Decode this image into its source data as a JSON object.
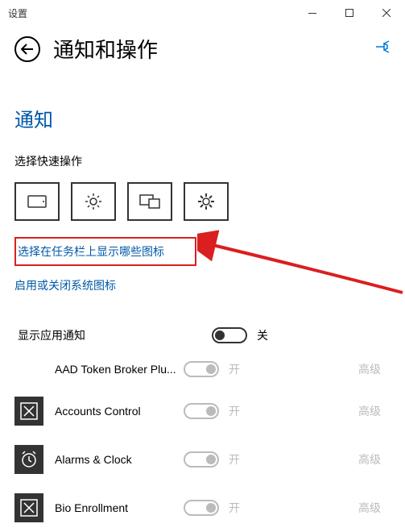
{
  "window": {
    "title": "设置"
  },
  "header": {
    "pageTitle": "通知和操作"
  },
  "section": {
    "heading": "通知",
    "quickActionsLabel": "选择快速操作",
    "link1": "选择在任务栏上显示哪些图标",
    "link2": "启用或关闭系统图标"
  },
  "masterToggle": {
    "label": "显示应用通知",
    "state": "关"
  },
  "apps": [
    {
      "name": "AAD Token Broker Plu...",
      "state": "开",
      "advanced": "高级",
      "hasIcon": false
    },
    {
      "name": "Accounts Control",
      "state": "开",
      "advanced": "高级",
      "hasIcon": true,
      "iconType": "box-x"
    },
    {
      "name": "Alarms & Clock",
      "state": "开",
      "advanced": "高级",
      "hasIcon": true,
      "iconType": "alarm"
    },
    {
      "name": "Bio Enrollment",
      "state": "开",
      "advanced": "高级",
      "hasIcon": true,
      "iconType": "box-x"
    }
  ]
}
